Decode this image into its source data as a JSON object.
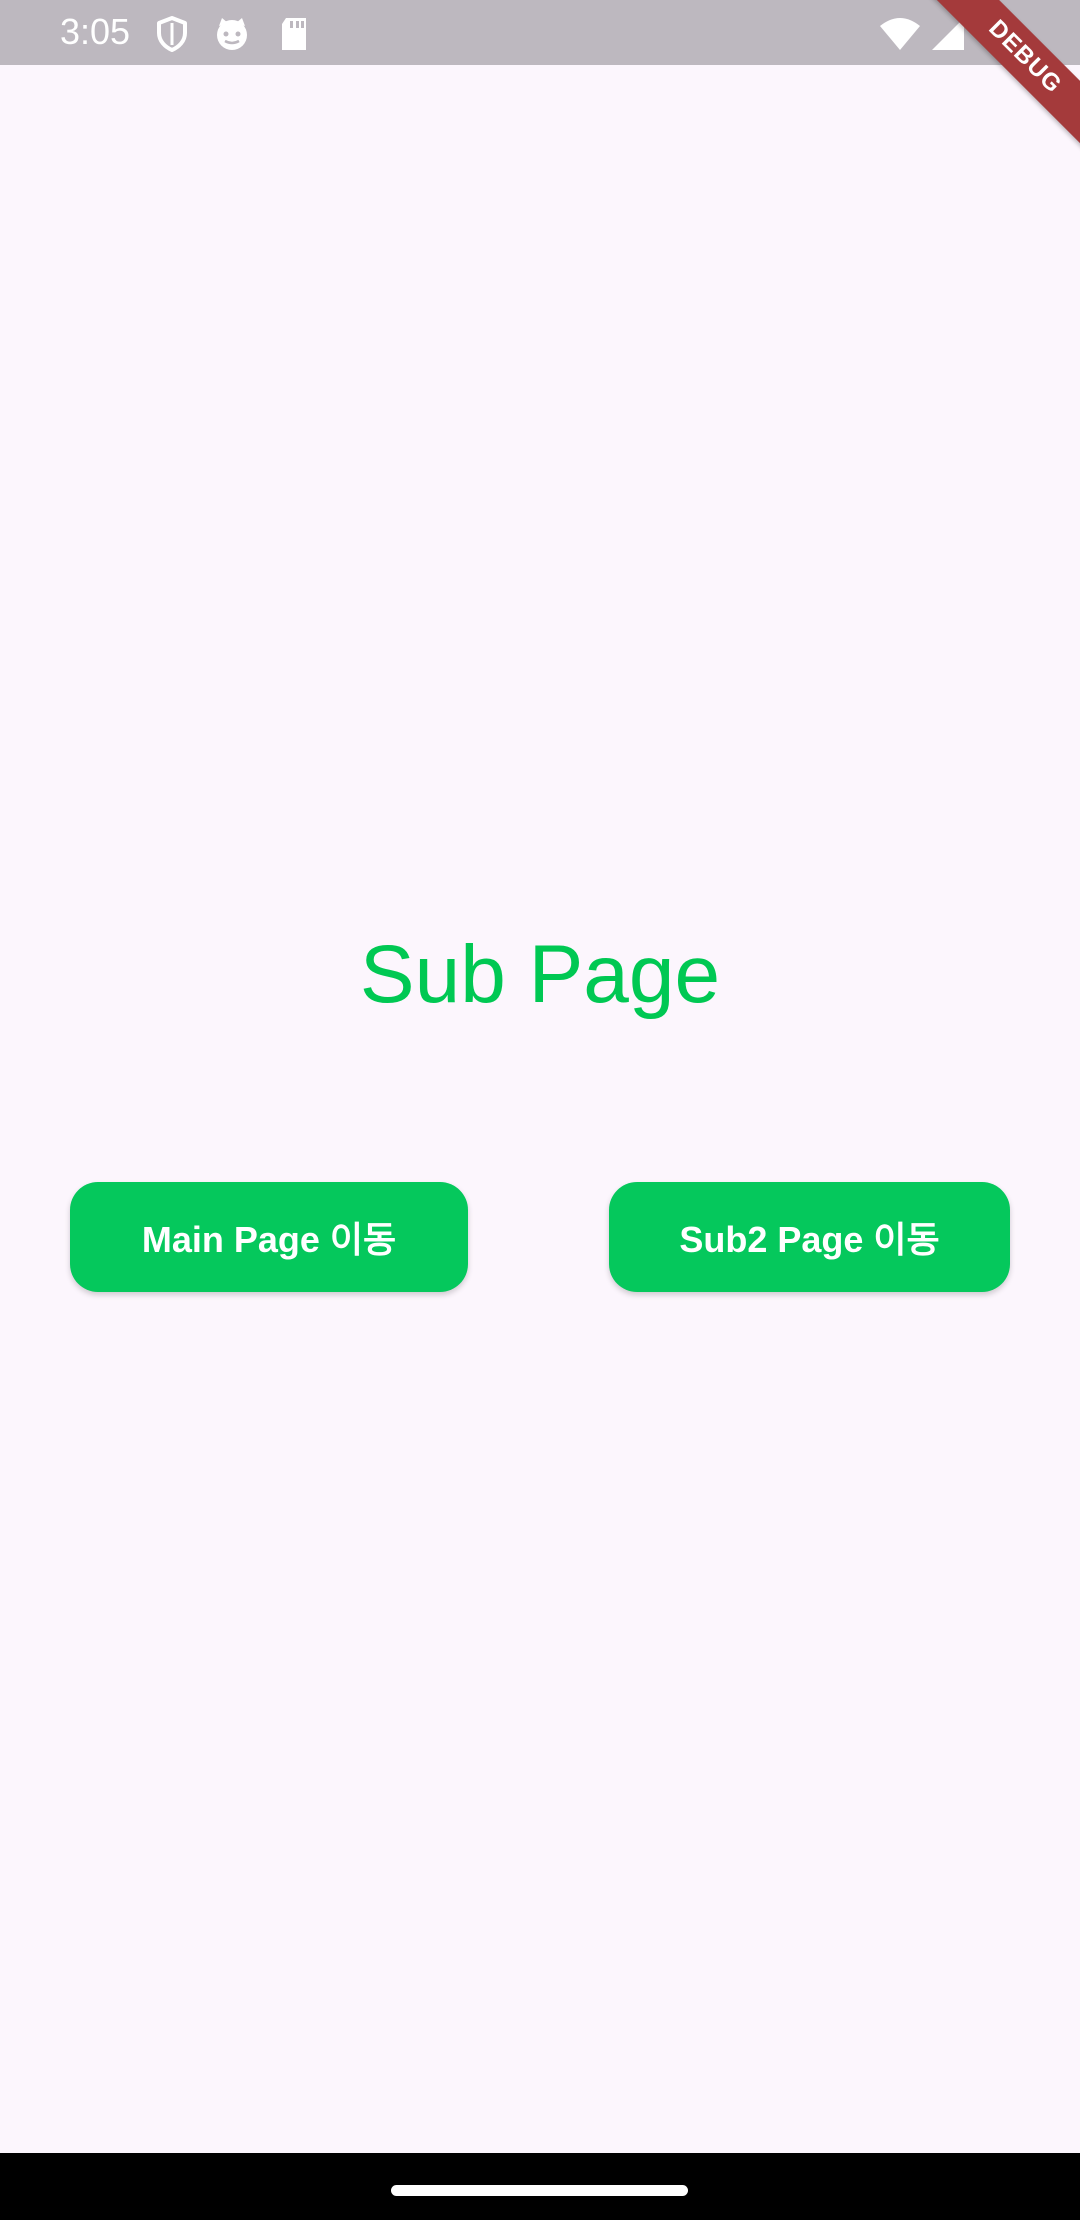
{
  "status_bar": {
    "time": "3:05",
    "icons_left": [
      "shield-icon",
      "cat-face-icon",
      "sd-card-icon"
    ],
    "icons_right": [
      "wifi-icon",
      "cellular-signal-icon"
    ]
  },
  "debug_banner": {
    "label": "DEBUG"
  },
  "main": {
    "title": "Sub Page",
    "buttons": {
      "main_page": "Main Page 이동",
      "sub2_page": "Sub2 Page 이동"
    }
  },
  "colors": {
    "accent": "#00c853",
    "button_bg": "#05c85c",
    "background": "#fcf6fd",
    "status_bar": "#bdb8bf",
    "debug_banner": "#a43a3b"
  }
}
